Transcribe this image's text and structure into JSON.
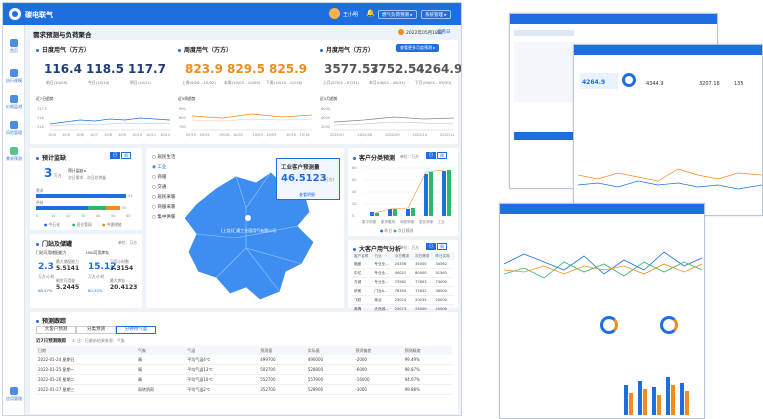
{
  "app": {
    "title": "碳电联气",
    "username": "王小明",
    "btn_forecast": "燃气负荷预测 ▸",
    "btn_system": "系统管理 ▸"
  },
  "sidebar": [
    {
      "label": "首页"
    },
    {
      "label": "执行规模"
    },
    {
      "label": "价格监测"
    },
    {
      "label": "风险管理"
    },
    {
      "label": "需求预测"
    }
  ],
  "sidebar_bottom": "应用管理",
  "page": {
    "title": "需求预测与负荷聚合",
    "date": "2022年05月18日",
    "date_btn": "查看日"
  },
  "daily": {
    "title": "日度用气（万方）",
    "values": [
      "116.4",
      "118.5",
      "117.7"
    ],
    "labels": [
      "前日(10/09)",
      "今日(10/10)",
      "明日(10/11)"
    ],
    "chart_title": "近7日趋势",
    "ticks": [
      "10/4",
      "10/5",
      "10/6",
      "10/7",
      "10/8",
      "10/9",
      "10/10",
      "10/11",
      "10/12"
    ],
    "y": [
      "117.5",
      "116",
      "114"
    ]
  },
  "weekly": {
    "title": "周度用气（万方）",
    "values": [
      "823.9",
      "829.5",
      "825.9"
    ],
    "labels": [
      "上周(9/26 - 10/02)",
      "本周(10/03 - 10/09)",
      "下周(10/10 - 10/16)"
    ],
    "chart_title": "近5周趋势",
    "ticks": [
      "09/19 - 09/25",
      "09/26 - 10/02",
      "10/03 - 10/09",
      "10/10 - 10/16"
    ],
    "y": [
      "900",
      "800",
      "700"
    ]
  },
  "monthly": {
    "title": "月度用气（万方）",
    "btn": "查看更多月度预测 ▸",
    "values": [
      "3577.57",
      "3752.54",
      "4264.9"
    ],
    "labels": [
      "上月(07/01 - 07/31)",
      "本月(08/01 - 08/31)",
      "下月(09/01 - 09/30)"
    ],
    "chart_title": "近5月趋势",
    "ticks": [
      "2022/07",
      "2022/08",
      "2022/09",
      "2022/10",
      "2022/11"
    ],
    "y": [
      "6000",
      "4000",
      "2000"
    ]
  },
  "alarm": {
    "title": "预计监缺",
    "tab1": "日",
    "tab2": "周",
    "value": "3",
    "unit": "万方",
    "desc1": "预计监缺 ▸",
    "desc2": "次日需求 - 次日总供量",
    "bar_labels": [
      "需求",
      "供给"
    ],
    "bar_vals": [
      "53",
      "50"
    ],
    "ticks": [
      "0",
      "10",
      "20",
      "30",
      "40",
      "50",
      "60"
    ],
    "legend": [
      "中石化",
      "昆仑管网",
      "中建储能"
    ]
  },
  "tank": {
    "title": "门站及储罐",
    "unit": "单位：万方",
    "sub1": "门站可用储配能力",
    "sub2": "LNG可用库存",
    "v1": "2.3",
    "u1": "万方/小时",
    "p1": "68.27%",
    "l1": "最大储配能力",
    "n1": "5.5141",
    "l2": "剩余可用量",
    "n2": "5.2445",
    "v2": "15.12",
    "u2": "万方/小时",
    "p2": "80.30%",
    "l3": "可用小时数",
    "n3": "3.3154",
    "l4": "最大库存",
    "n4": "20.4123"
  },
  "map": {
    "options": [
      "居民生活",
      "工业",
      "商服",
      "交通",
      "居民采暖",
      "商服采暖",
      "集中供暖"
    ],
    "forecast_title": "工业客户预测量",
    "forecast_value": "46.5123",
    "forecast_unit": "(万方)",
    "forecast_btn": "查看明细",
    "city_label": "(上饶)汇通工业园用气有限公司"
  },
  "customer": {
    "title": "客户分类预测",
    "unit": "单位：万方",
    "tab1": "日",
    "tab2": "周",
    "y": [
      "80",
      "60",
      "40",
      "20",
      "0"
    ],
    "cats": [
      "集中供暖",
      "集采暖用",
      "商服采暖",
      "居民采暖",
      "工业"
    ],
    "legend": [
      "昨日",
      "次日预测"
    ]
  },
  "bigcustomer": {
    "title": "大客户用气分析",
    "unit": "单位：万方",
    "tab1": "日",
    "tab2": "周",
    "headers": [
      "客户名称",
      "行业",
      "今日需求",
      "次日需求",
      "昨日实际"
    ],
    "rows": [
      [
        "福盛",
        "专业业...",
        "24356",
        "35000",
        "34562"
      ],
      [
        "中亿",
        "专业业...",
        "40021",
        "80000",
        "51563"
      ],
      [
        "万城",
        "专业业...",
        "75562",
        "77893",
        "73000"
      ],
      [
        "伊美",
        "门业A...",
        "76350",
        "77832",
        "36000"
      ],
      [
        "飞跃",
        "商业",
        "25024",
        "20035",
        "20000"
      ],
      [
        "希腾",
        "天然城...",
        "25073",
        "25000",
        "25000"
      ],
      [
        "华民",
        "天然城...",
        "23000",
        "23420",
        "22000"
      ]
    ]
  },
  "forecast": {
    "title": "预测跟踪",
    "tabs": [
      "大客户预测",
      "分类预测",
      "分钟用气量"
    ],
    "sub": "近7日预测跟踪",
    "sub_hint": "①  注：日最新结果来源：气象",
    "headers": [
      "日期",
      "气象",
      "气温",
      "预测量",
      "实际量",
      "预测偏差",
      "预测精度"
    ],
    "rows": [
      [
        "2022-01-24  星期日",
        "晴",
        "平均气温4℃",
        "499700",
        "490000",
        "-2000",
        "99.49%"
      ],
      [
        "2022-01-25  星期一",
        "晴",
        "平均气温13℃",
        "502700",
        "528800",
        "-6000",
        "98.87%"
      ],
      [
        "2022-01-26  星期二",
        "晴",
        "平均气温10℃",
        "552700",
        "557900",
        "-16000",
        "94.07%"
      ],
      [
        "2022-01-27  星期三",
        "雨转阴雨",
        "平均气温2℃",
        "352700",
        "528900",
        "-3000",
        "99.88%"
      ]
    ]
  },
  "mock1": {
    "kpi1": "4264.9",
    "kpi2": "4344.9",
    "kpi3": "3207.18",
    "kpi4": "135"
  },
  "colors": {
    "primary": "#1d6fe0",
    "orange": "#f08c1c",
    "navy": "#1f3d7a",
    "green": "#2fb66d"
  }
}
